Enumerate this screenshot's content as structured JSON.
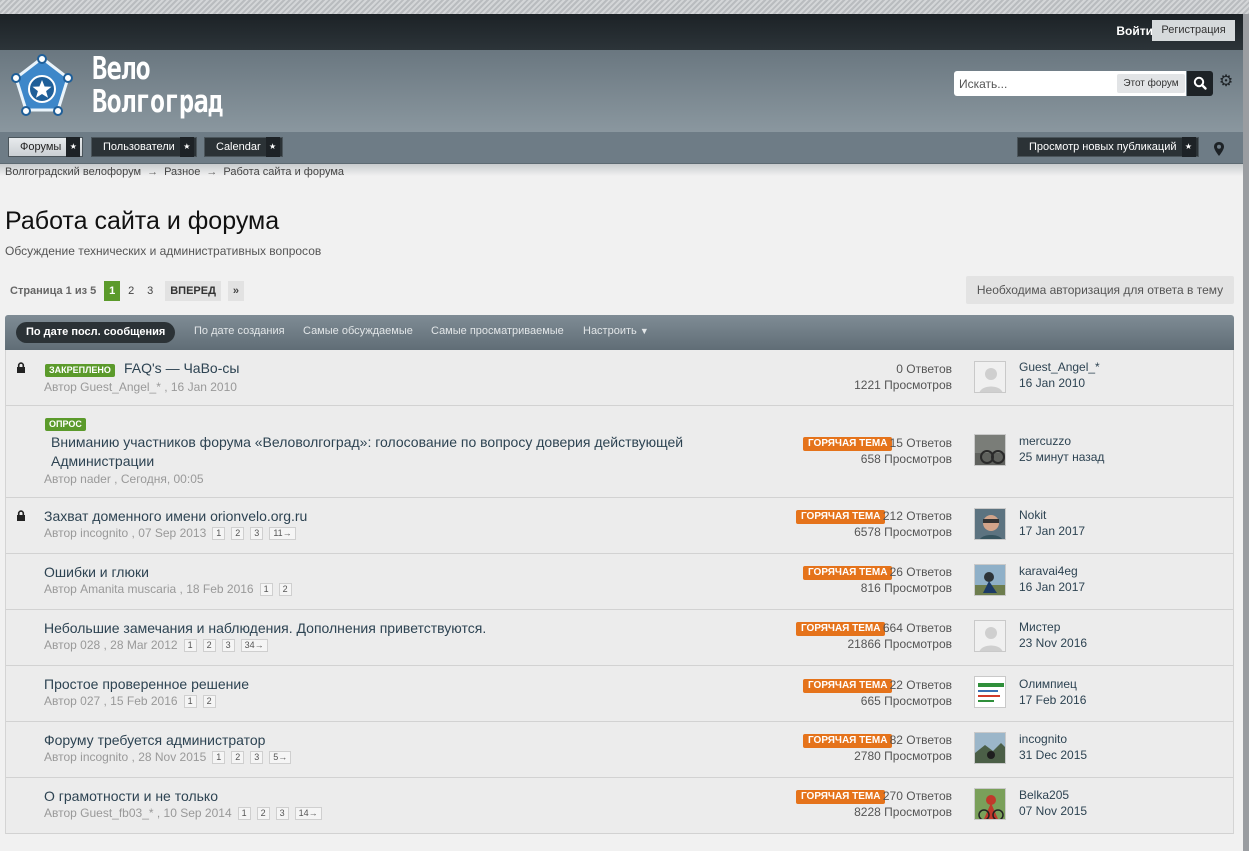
{
  "header": {
    "login_label": "Войти",
    "register_label": "Регистрация",
    "logo_line1": "Вело",
    "logo_line2": "Волгоград",
    "search_placeholder": "Искать...",
    "search_scope": "Этот форум"
  },
  "nav": {
    "tabs": [
      "Форумы",
      "Пользователи",
      "Calendar"
    ],
    "new_posts": "Просмотр новых публикаций"
  },
  "breadcrumb": [
    "Волгоградский велофорум",
    "Разное",
    "Работа сайта и форума"
  ],
  "breadcrumb_sep": "→",
  "page": {
    "title": "Работа сайта и форума",
    "description": "Обсуждение технических и административных вопросов"
  },
  "pager": {
    "label": "Страница 1 из 5",
    "pages": [
      "1",
      "2",
      "3"
    ],
    "next": "ВПЕРЕД",
    "last": "»"
  },
  "auth_note": "Необходима авторизация для ответа в тему",
  "sort": {
    "active": "По дате посл. сообщения",
    "options": [
      "По дате создания",
      "Самые обсуждаемые",
      "Самые просматриваемые"
    ],
    "customize": "Настроить"
  },
  "topics": [
    {
      "tag": "ЗАКРЕПЛЕНО",
      "title": "FAQ's — ЧаВо-сы",
      "author": "Автор Guest_Angel_* , 16 Jan 2010",
      "replies": "0 Ответов",
      "views": "1221 Просмотров",
      "last_user": "Guest_Angel_*",
      "last_date": "16 Jan 2010"
    },
    {
      "tag": "ОПРОС",
      "title_line1": "Вниманию участников форума «Веловолгоград»: голосование по вопросу доверия действующей",
      "title_line2": "Администрации",
      "author": "Автор nader , Сегодня, 00:05",
      "hot": "ГОРЯЧАЯ ТЕМА",
      "replies": "15 Ответов",
      "views": "658 Просмотров",
      "last_user": "mercuzzo",
      "last_date": "25 минут назад"
    },
    {
      "title": "Захват доменного имени orionvelo.org.ru",
      "author": "Автор incognito , 07 Sep 2013",
      "pages": [
        "1",
        "2",
        "3",
        "11→"
      ],
      "hot": "ГОРЯЧАЯ ТЕМА",
      "replies": "212 Ответов",
      "views": "6578 Просмотров",
      "last_user": "Nokit",
      "last_date": "17 Jan 2017"
    },
    {
      "title": "Ошибки и глюки",
      "author": "Автор Amanita muscaria , 18 Feb 2016",
      "pages": [
        "1",
        "2"
      ],
      "hot": "ГОРЯЧАЯ ТЕМА",
      "replies": "26 Ответов",
      "views": "816 Просмотров",
      "last_user": "karavai4eg",
      "last_date": "16 Jan 2017"
    },
    {
      "title": "Небольшие замечания и наблюдения. Дополнения приветствуются.",
      "author": "Автор 028 , 28 Mar 2012",
      "pages": [
        "1",
        "2",
        "3",
        "34→"
      ],
      "hot": "ГОРЯЧАЯ ТЕМА",
      "replies": "664 Ответов",
      "views": "21866 Просмотров",
      "last_user": "Мистер",
      "last_date": "23 Nov 2016"
    },
    {
      "title": "Простое проверенное решение",
      "author": "Автор 027 , 15 Feb 2016",
      "pages": [
        "1",
        "2"
      ],
      "hot": "ГОРЯЧАЯ ТЕМА",
      "replies": "22 Ответов",
      "views": "665 Просмотров",
      "last_user": "Олимпиец",
      "last_date": "17 Feb 2016"
    },
    {
      "title": "Форуму требуется администратор",
      "author": "Автор incognito , 28 Nov 2015",
      "pages": [
        "1",
        "2",
        "3",
        "5→"
      ],
      "hot": "ГОРЯЧАЯ ТЕМА",
      "replies": "82 Ответов",
      "views": "2780 Просмотров",
      "last_user": "incognito",
      "last_date": "31 Dec 2015"
    },
    {
      "title": "О грамотности и не только",
      "author": "Автор Guest_fb03_* , 10 Sep 2014",
      "pages": [
        "1",
        "2",
        "3",
        "14→"
      ],
      "hot": "ГОРЯЧАЯ ТЕМА",
      "replies": "270 Ответов",
      "views": "8228 Просмотров",
      "last_user": "Belka205",
      "last_date": "07 Nov 2015"
    }
  ],
  "colors": {
    "hot": "#e5731b",
    "tag_green": "#5b9a2b",
    "title_link": "#2d4352"
  }
}
